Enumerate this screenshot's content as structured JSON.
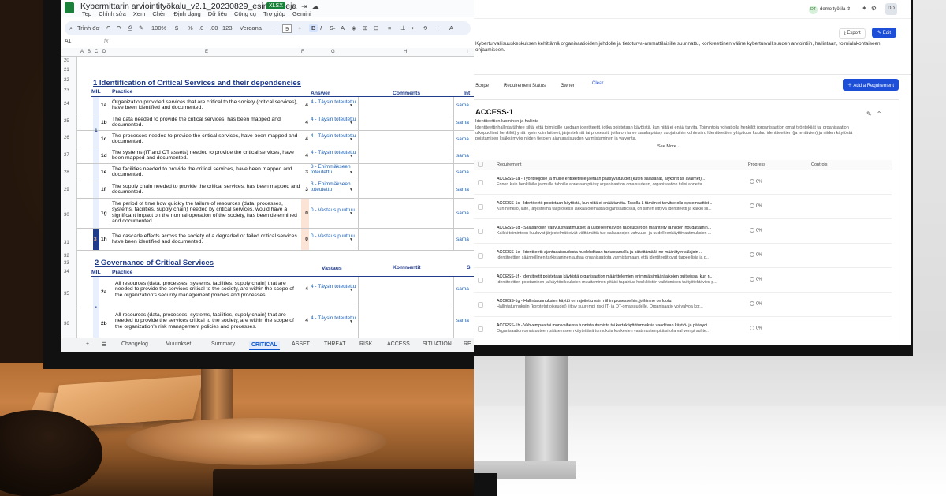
{
  "spreadsheet": {
    "title": "Kybermittarin arviointityökalu_v2.1_20230829_esimerkkeja",
    "file_badge": "XLSX",
    "menu": [
      "Tep",
      "Chỉnh sửa",
      "Xem",
      "Chèn",
      "Định dạng",
      "Dữ liệu",
      "Công cụ",
      "Trợ giúp",
      "Gemini"
    ],
    "toolbar": {
      "search": "Trình đơ",
      "zoom": "100%",
      "currency": "$",
      "percent": "%",
      "dec1": ".0",
      "dec2": ".00",
      "num_format": "123",
      "font": "Verdana",
      "font_size": "9",
      "bold": "B",
      "italic": "I"
    },
    "cell_ref": "A1",
    "fx": "fx",
    "column_headers": [
      "A",
      "B",
      "C",
      "D",
      "E",
      "F",
      "G",
      "H",
      "I"
    ],
    "row_numbers": [
      "20",
      "21",
      "22",
      "23",
      "24",
      "25",
      "26",
      "27",
      "28",
      "29",
      "30",
      "31",
      "32",
      "33",
      "34",
      "35",
      "36"
    ],
    "section1": {
      "title": "1  Identification of Critical Services and their dependencies",
      "headers": {
        "mil": "MIL",
        "practice": "Practice",
        "answer": "Answer",
        "comments": "Comments",
        "extra": "Int"
      },
      "mil_level": "1",
      "rows": [
        {
          "id": "1a",
          "practice": "Organization provided services that are critical to the society (critical services), have been identified and documented.",
          "score": "4",
          "answer": "4 - Täysin toteutettu",
          "link": "sama"
        },
        {
          "id": "1b",
          "practice": "The data needed to provide the critical services, has been mapped and documented.",
          "score": "4",
          "answer": "4 - Täysin toteutettu",
          "link": "sama"
        },
        {
          "id": "1c",
          "practice": "The processes needed to provide the critical services, have been mapped and documented.",
          "score": "4",
          "answer": "4 - Täysin toteutettu",
          "link": "sama"
        },
        {
          "id": "1d",
          "practice": "The systems (IT and OT assets) needed to provide the critical services, have been mapped and documented.",
          "score": "4",
          "answer": "4 - Täysin toteutettu",
          "link": "sama"
        },
        {
          "id": "1e",
          "practice": "The facilities needed to provide the critical services, have been mapped and documented.",
          "score": "3",
          "answer": "3 - Enimmäkseen toteutettu",
          "link": "sama"
        },
        {
          "id": "1f",
          "practice": "The supply chain needed to provide the critical services, has been mapped and documented.",
          "score": "3",
          "answer": "3 - Enimmäkseen toteutettu",
          "link": "sama"
        },
        {
          "id": "1g",
          "practice": "The period of time how quickly the failure of resources (data, processes, systems, facilities, supply chain) needed by critical services, would have a significant impact on the normal operation of the society, has been determined and documented.",
          "score": "0",
          "answer": "0 - Vastaus puuttuu",
          "link": "sama"
        },
        {
          "id": "1h",
          "practice": "The cascade effects across the society of a degraded or failed critical services have been identified and documented.",
          "score": "0",
          "answer": "0 - Vastaus puuttuu",
          "link": "sama",
          "mil": "3"
        }
      ]
    },
    "section2": {
      "title": "2  Governance of Critical Services",
      "headers": {
        "mil": "MIL",
        "practice": "Practice",
        "answer": "Vastaus",
        "comments": "Kommentit",
        "extra": "Si"
      },
      "mil_level": "1",
      "rows": [
        {
          "id": "2a",
          "practice": "All resources (data, processes, systems, facilities, supply chain) that are needed to provide the services critical to the society, are within the scope of the organization's security management policies and processes.",
          "score": "4",
          "answer": "4 - Täysin toteutettu",
          "link": "sama"
        },
        {
          "id": "2b",
          "practice": "All resources (data, processes, systems, facilities, supply chain) that are needed to provide the services critical to the society, are within the scope of the organization's risk management policies and processes.",
          "score": "4",
          "answer": "4 - Täysin toteutettu",
          "link": "sama"
        }
      ]
    },
    "tabs": [
      "+",
      "☰",
      "Changelog",
      "Muutokset",
      "Summary",
      "CRITICAL",
      "ASSET",
      "THREAT",
      "RISK",
      "ACCESS",
      "SITUATION",
      "RE"
    ]
  },
  "app": {
    "org": {
      "initials": "DT",
      "name": "demo työtila"
    },
    "user_initials": "DD",
    "export_label": "Export",
    "edit_label": "Edit",
    "description": "Kyberturvallisuuskeskuksen kehittämä organisaatioiden johdolle ja tietoturva-ammattilaisille suunnattu, konkreettinen väline kyberturvallisuuden arviointiin, hallintaan, toimialakohtaiseen ohjaamiseen.",
    "filters": {
      "scope": "Scope",
      "status": "Requirement Status",
      "owner": "Owner",
      "clear": "Clear"
    },
    "add_requirement": "Add a Requirement",
    "card": {
      "title": "ACCESS-1",
      "subtitle": "Identiteettien luominen ja hallinta",
      "description": "Identiteettinhallinta tähtee siltä, että toimijoille luodaan identiteetit, jotka poistetaan käytöstä, kun niitä ei enää tarvita. Toimintoja voivat olla henkilöt (organisaation omat työntekijät tai organisaation ulkopuoliset henkilöt) yhtä hyvin kuin laitteet, järjestelmät tai prosessit, joilla on tarve saada pääsy suojattuihin kohteisiin. Identiteettien ylläpitoon kuuluu identiteettien (ja tehtävien) ja niiden käytöstä poistamisen lisäksi myös niiden tietojen ajantasaisuuden varmistaminen ja valvonta.",
      "see_more": "See More",
      "columns": {
        "requirement": "Requirement",
        "progress": "Progress",
        "controls": "Controls"
      },
      "requirements": [
        {
          "title": "ACCESS-1a - Työntekijöille ja muille entiteeteille jaetaan pääsyvaltuudet (kuten salasanat, älykortit tai avaimet)...",
          "desc": "Ennen kuin henkilöille ja muille tahoille annetaan pääsy organisaation omaisuuteen, organisaation tulisi annetta...",
          "progress": "0%"
        },
        {
          "title": "ACCESS-1c - Identiteetit poistetaan käytöstä, kun niitä ei enää tarvita. Tasolla 1 tämän ei tarvitse olla systemaattist...",
          "desc": "Kun henkilö, laite, järjestelmä tai prosessi lakkaa olemasta organisaatiossa, on siihen liittyvä identiteetti ja kaikki sii...",
          "progress": "0%"
        },
        {
          "title": "ACCESS-1d - Salasanojen vahvuusvaatimukset ja uudelleenkäytön rajoitukset on määritelty ja niiden noudattamin...",
          "desc": "Kaikki toimintoon kuuluvat järjestelmät eivät välttämättä tue salasanojen vahvuus- ja uudelleenkäyttövaatimuksien ...",
          "progress": "0%"
        },
        {
          "title": "ACCESS-1e - Identiteetit ajantasaisuudesta huolehditaan tarkastamalla ja päivittämällä ne määrätyin välajoin ...",
          "desc": "Identiteettien säännöllinen tarkistaminen auttaa organisaatiota varmistamaan, että identiteetit ovat tarpeellisia ja p...",
          "progress": "0%"
        },
        {
          "title": "ACCESS-1f - Identiteetit poistetaan käytöstä organisaation määrittelemien enimmäisimääräaikojen puitteissa, kun n...",
          "desc": "Identiteettien poistaminen ja käyttöoikeuksien muuttaminen pitäisi tapahtua henkilöstön vaihtumisen tai työtehtävien p...",
          "progress": "0%"
        },
        {
          "title": "ACCESS-1g - Hallintatunnuksien käyttö on rajoitettu vain niihin prosesseihin, joihin ne on luotu.",
          "desc": "Hallintatunnuksiin (korotetut oikeudet) liittyy suurempi riski IT- ja OT-omaisuudelle. Organisaatio voi valvoa kor...",
          "progress": "0%"
        },
        {
          "title": "ACCESS-1h - Vahvempaa tai monivaiheista tunnistautumista tai kertakäyttötunnuksia vaaditaan käyttö- ja pääsyoi...",
          "desc": "Organisaation omaisuuteen pääsemiseen käytettävä tunnuksia koskevien vaatimusten pitäisi olla vahvempi suhte...",
          "progress": "0%"
        }
      ]
    }
  }
}
